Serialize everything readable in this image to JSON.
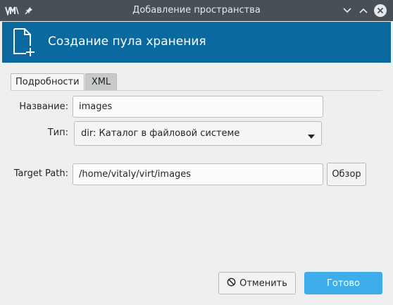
{
  "window": {
    "title": "Добавление пространства",
    "app_icon": "virt-manager-logo-icon",
    "pin_icon": "pin-icon",
    "minimize_icon": "chevron-down-icon",
    "maximize_icon": "chevron-up-icon",
    "close_icon": "close-icon"
  },
  "banner": {
    "title": "Создание пула хранения",
    "icon": "new-document-icon",
    "background": "#0a6aa0"
  },
  "tabs": [
    {
      "label": "Подробности",
      "active": true
    },
    {
      "label": "XML",
      "active": false
    }
  ],
  "form": {
    "name_label": "Название:",
    "name_value": "images",
    "type_label": "Тип:",
    "type_value": "dir: Каталог в файловой системе",
    "target_label": "Target Path:",
    "target_value": "/home/vitaly/virt/images",
    "browse_label": "Обзор"
  },
  "footer": {
    "cancel_label": "Отменить",
    "cancel_icon": "cancel-icon",
    "finish_label": "Готово",
    "accent": "#3daee9"
  }
}
